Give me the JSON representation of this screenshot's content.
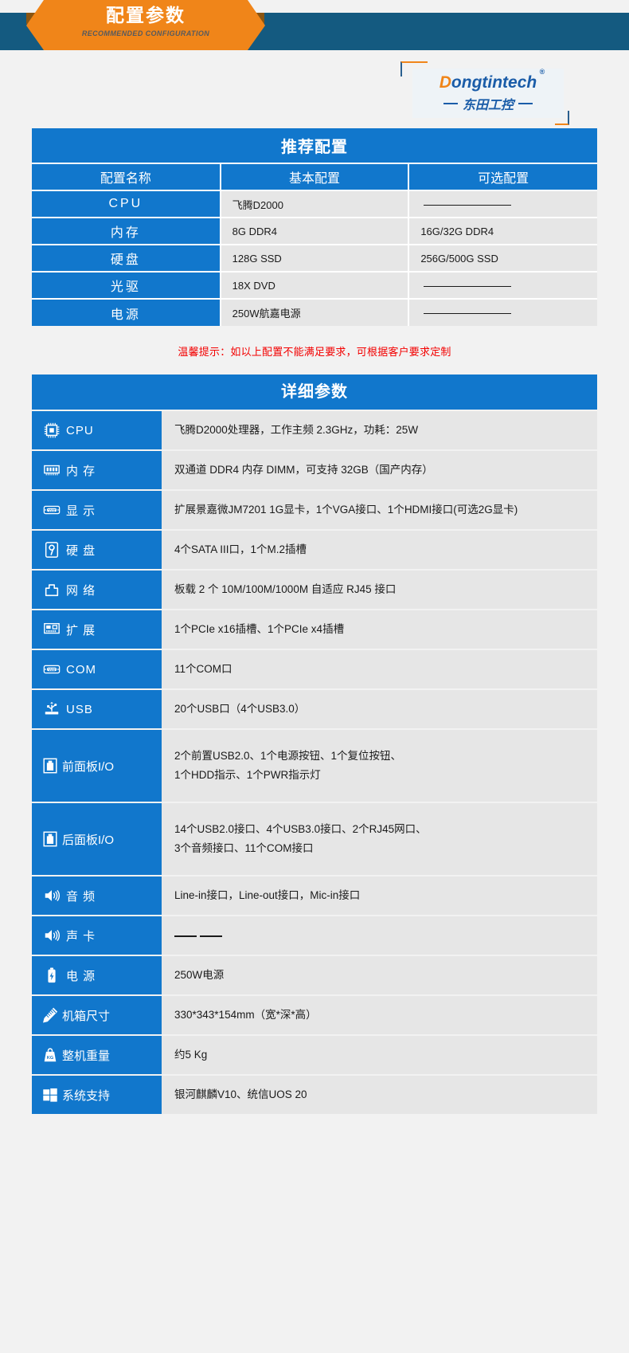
{
  "banner": {
    "title": "配置参数",
    "subtitle": "RECOMMENDED CONFIGURATION"
  },
  "logo": {
    "letter": "D",
    "rest": "ongtintech",
    "reg": "®",
    "chinese": "东田工控"
  },
  "recommended": {
    "title": "推荐配置",
    "columns": [
      "配置名称",
      "基本配置",
      "可选配置"
    ],
    "rows": [
      {
        "name": "CPU",
        "basic": "飞腾D2000",
        "option": "",
        "option_dash": true
      },
      {
        "name": "内存",
        "basic": "8G DDR4",
        "option": "16G/32G DDR4",
        "option_dash": false
      },
      {
        "name": "硬盘",
        "basic": "128G SSD",
        "option": "256G/500G SSD",
        "option_dash": false
      },
      {
        "name": "光驱",
        "basic": "18X DVD",
        "option": "",
        "option_dash": true
      },
      {
        "name": "电源",
        "basic": "250W航嘉电源",
        "option": "",
        "option_dash": true
      }
    ],
    "notice": "温馨提示：如以上配置不能满足要求，可根据客户要求定制"
  },
  "detail": {
    "title": "详细参数",
    "rows": [
      {
        "label": "CPU",
        "icon": "cpu-chip-icon",
        "lines": [
          "飞腾D2000处理器，工作主频 2.3GHz，功耗：25W"
        ]
      },
      {
        "label": "内 存",
        "icon": "memory-module-icon",
        "lines": [
          "双通道 DDR4 内存 DIMM，可支持 32GB（国产内存）"
        ]
      },
      {
        "label": "显 示",
        "icon": "vga-port-icon",
        "lines": [
          "扩展景嘉微JM7201 1G显卡，1个VGA接口、1个HDMI接口(可选2G显卡)"
        ]
      },
      {
        "label": "硬 盘",
        "icon": "hard-disk-icon",
        "lines": [
          "4个SATA III口，1个M.2插槽"
        ]
      },
      {
        "label": "网 络",
        "icon": "rj45-network-icon",
        "lines": [
          "板载 2 个 10M/100M/1000M 自适应 RJ45 接口"
        ]
      },
      {
        "label": "扩 展",
        "icon": "expansion-card-icon",
        "lines": [
          "1个PCIe x16插槽、1个PCIe x4插槽"
        ]
      },
      {
        "label": "COM",
        "icon": "serial-port-icon",
        "lines": [
          "11个COM口"
        ]
      },
      {
        "label": "USB",
        "icon": "usb-icon",
        "lines": [
          "20个USB口（4个USB3.0）"
        ]
      },
      {
        "label": "前面板I/O",
        "icon": "front-panel-icon",
        "lines": [
          "2个前置USB2.0、1个电源按钮、1个复位按钮、",
          "1个HDD指示、1个PWR指示灯"
        ]
      },
      {
        "label": "后面板I/O",
        "icon": "rear-panel-icon",
        "lines": [
          "14个USB2.0接口、4个USB3.0接口、2个RJ45网口、",
          "3个音频接口、11个COM接口"
        ]
      },
      {
        "label": "音 频",
        "icon": "speaker-icon",
        "lines": [
          "Line-in接口，Line-out接口，Mic-in接口"
        ]
      },
      {
        "label": "声 卡",
        "icon": "speaker-icon",
        "lines": [
          ""
        ]
      },
      {
        "label": "电 源",
        "icon": "battery-power-icon",
        "lines": [
          "250W电源"
        ]
      },
      {
        "label": "机箱尺寸",
        "icon": "ruler-pencil-icon",
        "lines": [
          "330*343*154mm（宽*深*高）"
        ]
      },
      {
        "label": "整机重量",
        "icon": "weight-kg-icon",
        "lines": [
          "约5 Kg"
        ]
      },
      {
        "label": "系统支持",
        "icon": "windows-os-icon",
        "lines": [
          "银河麒麟V10、统信UOS 20"
        ]
      }
    ]
  },
  "colors": {
    "primary_blue": "#1177cc",
    "dark_blue": "#145a80",
    "orange": "#f08519",
    "red_notice": "#f30000",
    "cell_gray": "#e6e6e6"
  }
}
